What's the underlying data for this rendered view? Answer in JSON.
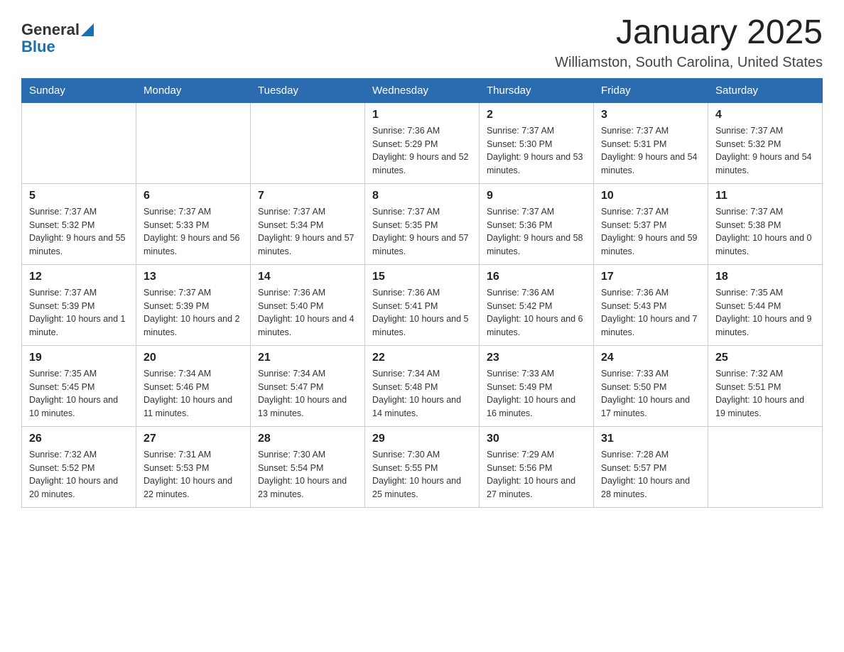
{
  "header": {
    "logo_general": "General",
    "logo_blue": "Blue",
    "month_year": "January 2025",
    "location": "Williamston, South Carolina, United States"
  },
  "days_of_week": [
    "Sunday",
    "Monday",
    "Tuesday",
    "Wednesday",
    "Thursday",
    "Friday",
    "Saturday"
  ],
  "weeks": [
    [
      {
        "day": "",
        "info": ""
      },
      {
        "day": "",
        "info": ""
      },
      {
        "day": "",
        "info": ""
      },
      {
        "day": "1",
        "info": "Sunrise: 7:36 AM\nSunset: 5:29 PM\nDaylight: 9 hours and 52 minutes."
      },
      {
        "day": "2",
        "info": "Sunrise: 7:37 AM\nSunset: 5:30 PM\nDaylight: 9 hours and 53 minutes."
      },
      {
        "day": "3",
        "info": "Sunrise: 7:37 AM\nSunset: 5:31 PM\nDaylight: 9 hours and 54 minutes."
      },
      {
        "day": "4",
        "info": "Sunrise: 7:37 AM\nSunset: 5:32 PM\nDaylight: 9 hours and 54 minutes."
      }
    ],
    [
      {
        "day": "5",
        "info": "Sunrise: 7:37 AM\nSunset: 5:32 PM\nDaylight: 9 hours and 55 minutes."
      },
      {
        "day": "6",
        "info": "Sunrise: 7:37 AM\nSunset: 5:33 PM\nDaylight: 9 hours and 56 minutes."
      },
      {
        "day": "7",
        "info": "Sunrise: 7:37 AM\nSunset: 5:34 PM\nDaylight: 9 hours and 57 minutes."
      },
      {
        "day": "8",
        "info": "Sunrise: 7:37 AM\nSunset: 5:35 PM\nDaylight: 9 hours and 57 minutes."
      },
      {
        "day": "9",
        "info": "Sunrise: 7:37 AM\nSunset: 5:36 PM\nDaylight: 9 hours and 58 minutes."
      },
      {
        "day": "10",
        "info": "Sunrise: 7:37 AM\nSunset: 5:37 PM\nDaylight: 9 hours and 59 minutes."
      },
      {
        "day": "11",
        "info": "Sunrise: 7:37 AM\nSunset: 5:38 PM\nDaylight: 10 hours and 0 minutes."
      }
    ],
    [
      {
        "day": "12",
        "info": "Sunrise: 7:37 AM\nSunset: 5:39 PM\nDaylight: 10 hours and 1 minute."
      },
      {
        "day": "13",
        "info": "Sunrise: 7:37 AM\nSunset: 5:39 PM\nDaylight: 10 hours and 2 minutes."
      },
      {
        "day": "14",
        "info": "Sunrise: 7:36 AM\nSunset: 5:40 PM\nDaylight: 10 hours and 4 minutes."
      },
      {
        "day": "15",
        "info": "Sunrise: 7:36 AM\nSunset: 5:41 PM\nDaylight: 10 hours and 5 minutes."
      },
      {
        "day": "16",
        "info": "Sunrise: 7:36 AM\nSunset: 5:42 PM\nDaylight: 10 hours and 6 minutes."
      },
      {
        "day": "17",
        "info": "Sunrise: 7:36 AM\nSunset: 5:43 PM\nDaylight: 10 hours and 7 minutes."
      },
      {
        "day": "18",
        "info": "Sunrise: 7:35 AM\nSunset: 5:44 PM\nDaylight: 10 hours and 9 minutes."
      }
    ],
    [
      {
        "day": "19",
        "info": "Sunrise: 7:35 AM\nSunset: 5:45 PM\nDaylight: 10 hours and 10 minutes."
      },
      {
        "day": "20",
        "info": "Sunrise: 7:34 AM\nSunset: 5:46 PM\nDaylight: 10 hours and 11 minutes."
      },
      {
        "day": "21",
        "info": "Sunrise: 7:34 AM\nSunset: 5:47 PM\nDaylight: 10 hours and 13 minutes."
      },
      {
        "day": "22",
        "info": "Sunrise: 7:34 AM\nSunset: 5:48 PM\nDaylight: 10 hours and 14 minutes."
      },
      {
        "day": "23",
        "info": "Sunrise: 7:33 AM\nSunset: 5:49 PM\nDaylight: 10 hours and 16 minutes."
      },
      {
        "day": "24",
        "info": "Sunrise: 7:33 AM\nSunset: 5:50 PM\nDaylight: 10 hours and 17 minutes."
      },
      {
        "day": "25",
        "info": "Sunrise: 7:32 AM\nSunset: 5:51 PM\nDaylight: 10 hours and 19 minutes."
      }
    ],
    [
      {
        "day": "26",
        "info": "Sunrise: 7:32 AM\nSunset: 5:52 PM\nDaylight: 10 hours and 20 minutes."
      },
      {
        "day": "27",
        "info": "Sunrise: 7:31 AM\nSunset: 5:53 PM\nDaylight: 10 hours and 22 minutes."
      },
      {
        "day": "28",
        "info": "Sunrise: 7:30 AM\nSunset: 5:54 PM\nDaylight: 10 hours and 23 minutes."
      },
      {
        "day": "29",
        "info": "Sunrise: 7:30 AM\nSunset: 5:55 PM\nDaylight: 10 hours and 25 minutes."
      },
      {
        "day": "30",
        "info": "Sunrise: 7:29 AM\nSunset: 5:56 PM\nDaylight: 10 hours and 27 minutes."
      },
      {
        "day": "31",
        "info": "Sunrise: 7:28 AM\nSunset: 5:57 PM\nDaylight: 10 hours and 28 minutes."
      },
      {
        "day": "",
        "info": ""
      }
    ]
  ]
}
